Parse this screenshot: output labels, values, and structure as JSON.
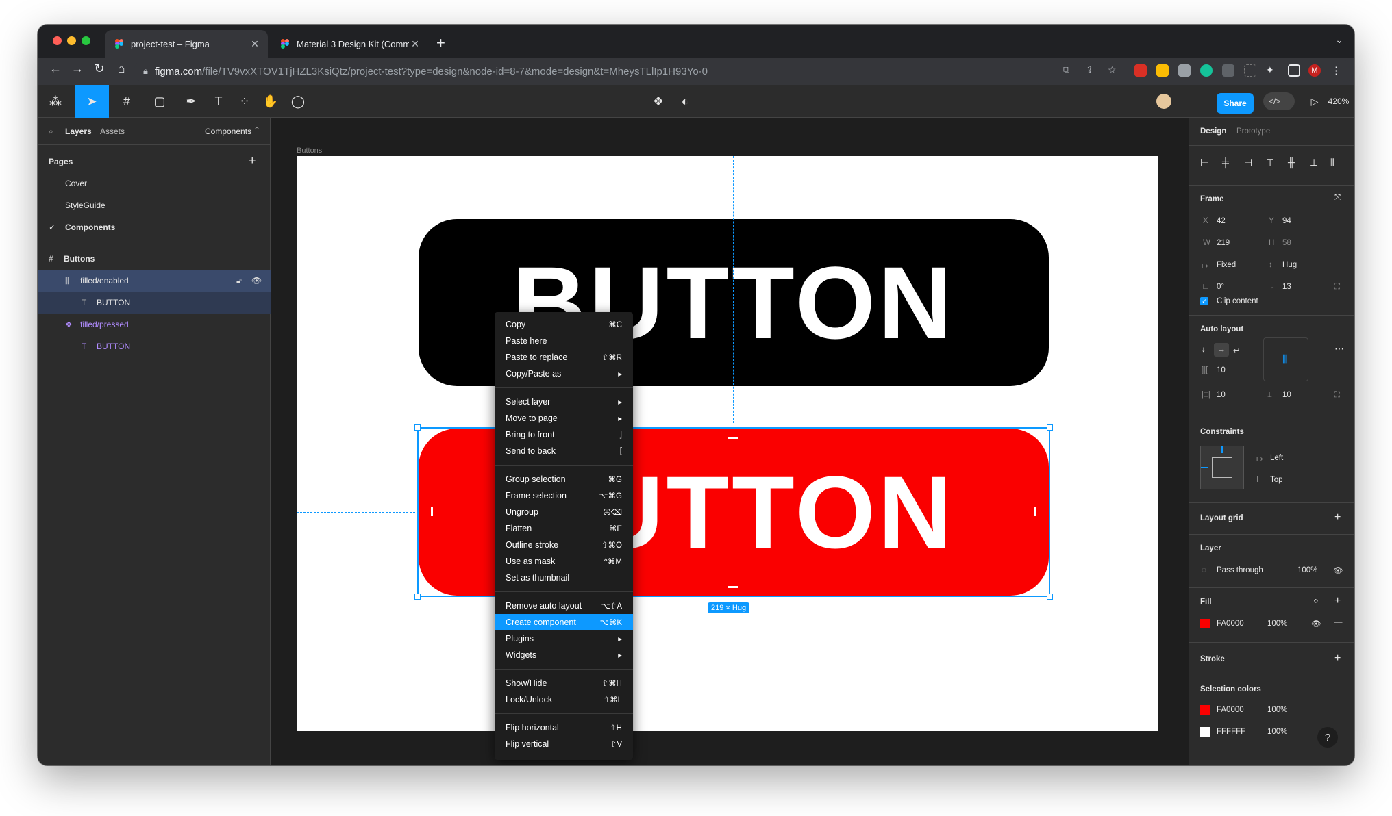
{
  "browser": {
    "tabs": [
      {
        "title": "project-test – Figma",
        "active": true
      },
      {
        "title": "Material 3 Design Kit (Commu",
        "active": false
      }
    ],
    "url_host": "figma.com",
    "url_path": "/file/TV9vxXTOV1TjHZL3KsiQtz/project-test?type=design&node-id=8-7&mode=design&t=MheysTLlIp1H93Yo-0",
    "profile_initial": "M"
  },
  "toolbar": {
    "share_label": "Share",
    "zoom": "420%",
    "accent": "#0d99ff"
  },
  "left_panel": {
    "tab_layers": "Layers",
    "tab_assets": "Assets",
    "page_dropdown": "Components",
    "pages_heading": "Pages",
    "pages": [
      "Cover",
      "StyleGuide",
      "Components"
    ],
    "current_page": "Components",
    "layers": [
      {
        "name": "Buttons",
        "icon": "frame-icon"
      },
      {
        "name": "filled/enabled",
        "icon": "auto-layout-icon"
      },
      {
        "name": "BUTTON",
        "icon": "text-icon"
      },
      {
        "name": "filled/pressed",
        "icon": "component-icon"
      },
      {
        "name": "BUTTON",
        "icon": "text-icon"
      }
    ]
  },
  "canvas": {
    "frame_label": "Buttons",
    "button_top_text": "BUTTON",
    "button_bottom_text": "BUTTON",
    "size_badge": "219 × Hug"
  },
  "context_menu": {
    "groups": [
      [
        {
          "label": "Copy",
          "shortcut": "⌘C"
        },
        {
          "label": "Paste here",
          "shortcut": ""
        },
        {
          "label": "Paste to replace",
          "shortcut": "⇧⌘R"
        },
        {
          "label": "Copy/Paste as",
          "shortcut": "▸"
        }
      ],
      [
        {
          "label": "Select layer",
          "shortcut": "▸"
        },
        {
          "label": "Move to page",
          "shortcut": "▸"
        },
        {
          "label": "Bring to front",
          "shortcut": "]"
        },
        {
          "label": "Send to back",
          "shortcut": "["
        }
      ],
      [
        {
          "label": "Group selection",
          "shortcut": "⌘G"
        },
        {
          "label": "Frame selection",
          "shortcut": "⌥⌘G"
        },
        {
          "label": "Ungroup",
          "shortcut": "⌘⌫"
        },
        {
          "label": "Flatten",
          "shortcut": "⌘E"
        },
        {
          "label": "Outline stroke",
          "shortcut": "⇧⌘O"
        },
        {
          "label": "Use as mask",
          "shortcut": "^⌘M"
        },
        {
          "label": "Set as thumbnail",
          "shortcut": ""
        }
      ],
      [
        {
          "label": "Remove auto layout",
          "shortcut": "⌥⇧A"
        },
        {
          "label": "Create component",
          "shortcut": "⌥⌘K",
          "highlighted": true
        },
        {
          "label": "Plugins",
          "shortcut": "▸"
        },
        {
          "label": "Widgets",
          "shortcut": "▸"
        }
      ],
      [
        {
          "label": "Show/Hide",
          "shortcut": "⇧⌘H"
        },
        {
          "label": "Lock/Unlock",
          "shortcut": "⇧⌘L"
        }
      ],
      [
        {
          "label": "Flip horizontal",
          "shortcut": "⇧H"
        },
        {
          "label": "Flip vertical",
          "shortcut": "⇧V"
        }
      ]
    ]
  },
  "right_panel": {
    "tab_design": "Design",
    "tab_prototype": "Prototype",
    "frame": {
      "heading": "Frame",
      "x_label": "X",
      "x": "42",
      "y_label": "Y",
      "y": "94",
      "w_label": "W",
      "w": "219",
      "h_label": "H",
      "h": "58",
      "width_mode": "Fixed",
      "height_mode": "Hug",
      "rotation": "0°",
      "radius": "13",
      "clip_label": "Clip content"
    },
    "auto_layout": {
      "heading": "Auto layout",
      "gap": "10",
      "padding_h": "10",
      "padding_v": "10"
    },
    "constraints": {
      "heading": "Constraints",
      "horizontal": "Left",
      "vertical": "Top"
    },
    "layout_grid": "Layout grid",
    "layer": {
      "heading": "Layer",
      "blend": "Pass through",
      "opacity": "100%"
    },
    "fill": {
      "heading": "Fill",
      "hex": "FA0000",
      "opacity": "100%",
      "color": "#fa0000"
    },
    "stroke": "Stroke",
    "selection_colors": {
      "heading": "Selection colors",
      "items": [
        {
          "hex": "FA0000",
          "opacity": "100%",
          "color": "#fa0000"
        },
        {
          "hex": "FFFFFF",
          "opacity": "100%",
          "color": "#ffffff"
        }
      ]
    },
    "help": "?"
  }
}
